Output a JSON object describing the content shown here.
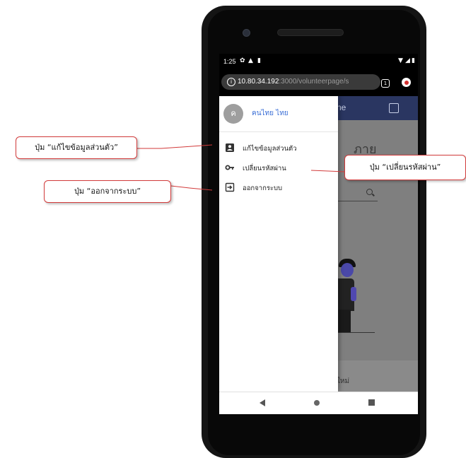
{
  "statusbar": {
    "time": "1:25",
    "left_icons": [
      "gear-icon",
      "warning-icon",
      "sdcard-icon"
    ],
    "right_icons": [
      "wifi-icon",
      "signal-icon",
      "battery-icon"
    ]
  },
  "browser": {
    "url_host": "10.80.34.192",
    "url_rest": ":3000/volunteerpage/s",
    "tab_count": "1"
  },
  "app": {
    "header_text": "ne",
    "background_heading": "ภาย",
    "background_bottom_text": "ใหม่"
  },
  "drawer": {
    "avatar_initial": "ค",
    "user_name": "คนไทย ไทย",
    "items": [
      {
        "label": "แก้ไขข้อมูลส่วนตัว",
        "icon": "account-box-icon"
      },
      {
        "label": "เปลี่ยนรหัสผ่าน",
        "icon": "key-icon"
      },
      {
        "label": "ออกจากระบบ",
        "icon": "logout-icon"
      }
    ]
  },
  "annotations": {
    "edit_profile": "ปุ่ม “แก้ไขข้อมูลส่วนตัว”",
    "change_password": "ปุ่ม “เปลี่ยนรหัสผ่าน”",
    "logout": "ปุ่ม “ออกจากระบบ”"
  },
  "colors": {
    "accent_name": "#3b6fd6",
    "header_bg": "#2a3661",
    "callout_border": "#d23a3a"
  }
}
